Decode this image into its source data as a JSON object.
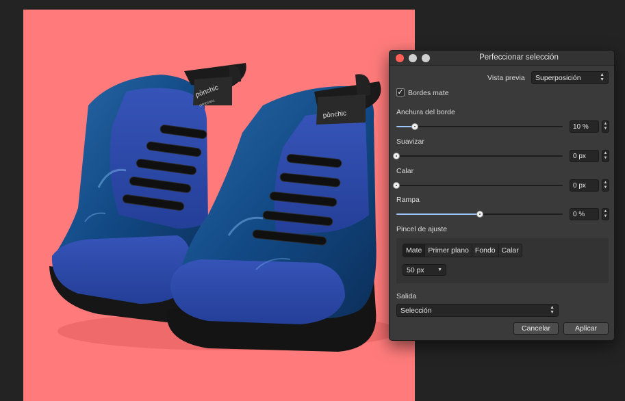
{
  "dialog": {
    "title": "Perfeccionar selección",
    "preview": {
      "label": "Vista previa",
      "value": "Superposición"
    },
    "matte_edges": {
      "label": "Bordes mate",
      "checked": true,
      "check_glyph": "✓"
    },
    "sliders": [
      {
        "label": "Anchura del borde",
        "value": "10 %",
        "fraction": 0.11
      },
      {
        "label": "Suavizar",
        "value": "0 px",
        "fraction": 0.0
      },
      {
        "label": "Calar",
        "value": "0 px",
        "fraction": 0.0
      },
      {
        "label": "Rampa",
        "value": "0 %",
        "fraction": 0.5
      }
    ],
    "brush": {
      "label": "Pincel de ajuste",
      "modes": [
        "Mate",
        "Primer plano",
        "Fondo",
        "Calar"
      ],
      "active_mode": "Mate",
      "size": "50 px"
    },
    "output": {
      "label": "Salida",
      "value": "Selección"
    },
    "buttons": {
      "cancel": "Cancelar",
      "apply": "Aplicar"
    }
  },
  "canvas": {
    "background_color": "#ff7b7b",
    "brand_text": "pònchic",
    "brand_subtext": "ORIGINAL"
  },
  "colors": {
    "slider_fill": "#9cc7ff",
    "close": "#ff5f57",
    "traffic_gray": "#cfcfcf",
    "shoe_blue": "#2b47a8"
  }
}
